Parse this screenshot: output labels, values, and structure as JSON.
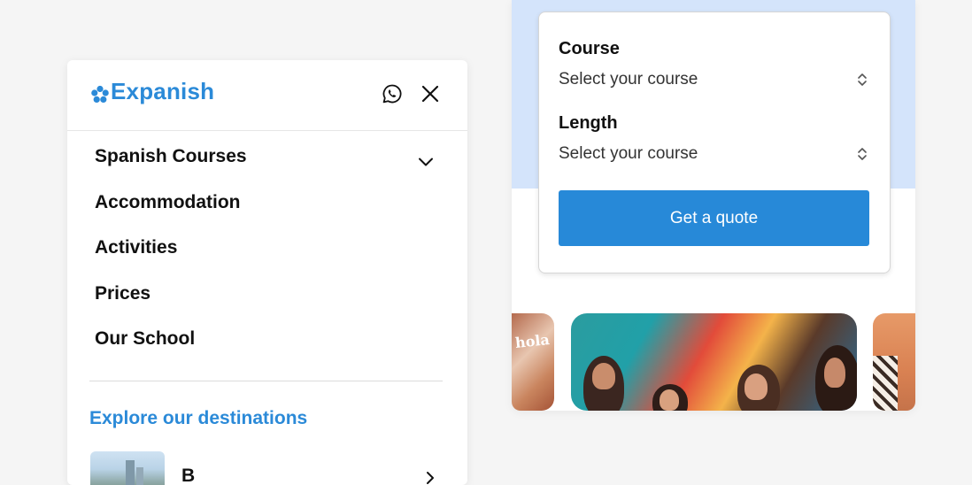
{
  "menu": {
    "logo_text": "Expanish",
    "nav_items": [
      {
        "label": "Spanish Courses"
      },
      {
        "label": "Accommodation"
      },
      {
        "label": "Activities"
      },
      {
        "label": "Prices"
      },
      {
        "label": "Our School"
      }
    ],
    "explore_heading": "Explore our destinations",
    "destination_partial": "B"
  },
  "quote": {
    "course_label": "Course",
    "course_value": "Select your course",
    "length_label": "Length",
    "length_value": "Select your course",
    "button_label": "Get a quote"
  },
  "photos": {
    "left_sign_text": "hola"
  },
  "colors": {
    "brand_blue": "#2b8ad8",
    "button_blue": "#2789d8",
    "band_blue": "#d4e4fb"
  },
  "icons": [
    "whatsapp-icon",
    "close-icon",
    "chevron-down-icon",
    "chevron-right-icon",
    "updown-icon",
    "logo-flower-icon"
  ]
}
